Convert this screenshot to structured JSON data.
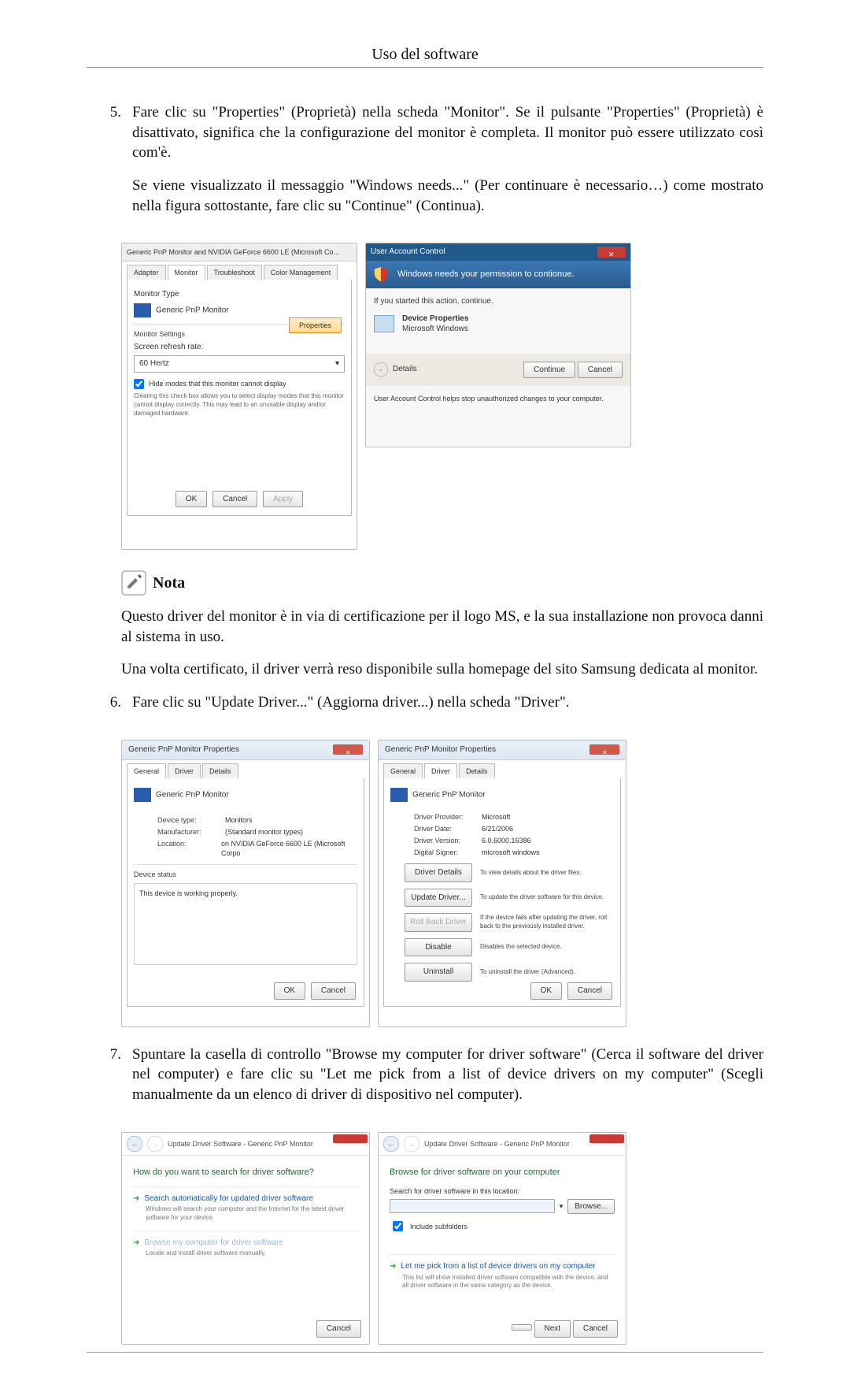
{
  "header": {
    "title": "Uso del software"
  },
  "steps": {
    "s5": {
      "num": "5.",
      "para1": "Fare clic su \"Properties\" (Proprietà) nella scheda \"Monitor\". Se il pulsante \"Properties\" (Proprietà) è disattivato, significa che la configurazione del monitor è completa. Il monitor può essere utilizzato così com'è.",
      "para2": "Se viene visualizzato il messaggio \"Windows needs...\" (Per continuare è necessario…) come mostrato nella figura sottostante, fare clic su \"Continue\" (Continua)."
    },
    "s6": {
      "num": "6.",
      "para1": "Fare clic su \"Update Driver...\" (Aggiorna driver...) nella scheda \"Driver\"."
    },
    "s7": {
      "num": "7.",
      "para1": "Spuntare la casella di controllo \"Browse my computer for driver software\" (Cerca il software del driver nel computer) e fare clic su \"Let me pick from a list of device drivers on my computer\" (Scegli manualmente da un elenco di driver di dispositivo nel computer)."
    }
  },
  "nota": {
    "label": "Nota",
    "p1": "Questo driver del monitor è in via di certificazione per il logo MS, e la sua installazione non provoca danni al sistema in uso.",
    "p2": "Una volta certificato, il driver verrà reso disponibile sulla homepage del sito Samsung dedicata al monitor."
  },
  "shot_monitor": {
    "title": "Generic PnP Monitor and NVIDIA GeForce 6600 LE (Microsoft Co...",
    "tabs": {
      "adapter": "Adapter",
      "monitor": "Monitor",
      "trouble": "Troubleshoot",
      "color": "Color Management"
    },
    "type_label": "Monitor Type",
    "type_value": "Generic PnP Monitor",
    "properties_btn": "Properties",
    "settings_label": "Monitor Settings",
    "refresh_label": "Screen refresh rate:",
    "refresh_value": "60 Hertz",
    "hide_modes": "Hide modes that this monitor cannot display",
    "hide_modes_desc": "Clearing this check box allows you to select display modes that this monitor cannot display correctly. This may lead to an unusable display and/or damaged hardware.",
    "ok": "OK",
    "cancel": "Cancel",
    "apply": "Apply"
  },
  "shot_uac": {
    "title": "User Account Control",
    "headline": "Windows needs your permission to contionue.",
    "if_started": "If you started this action, continue.",
    "dev_name": "Device Properties",
    "dev_vendor": "Microsoft Windows",
    "details": "Details",
    "continue": "Continue",
    "cancel": "Cancel",
    "footer": "User Account Control helps stop unauthorized changes to your computer."
  },
  "shot_general": {
    "title": "Generic PnP Monitor Properties",
    "tabs": {
      "general": "General",
      "driver": "Driver",
      "details": "Details"
    },
    "name": "Generic PnP Monitor",
    "kv": {
      "device_type_k": "Device type:",
      "device_type_v": "Monitors",
      "manufacturer_k": "Manufacturer:",
      "manufacturer_v": "(Standard monitor types)",
      "location_k": "Location:",
      "location_v": "on NVIDIA GeForce 6600 LE (Microsoft Corpo"
    },
    "status_label": "Device status",
    "status_text": "This device is working properly.",
    "ok": "OK",
    "cancel": "Cancel"
  },
  "shot_driver": {
    "title": "Generic PnP Monitor Properties",
    "name": "Generic PnP Monitor",
    "kv": {
      "provider_k": "Driver Provider:",
      "provider_v": "Microsoft",
      "date_k": "Driver Date:",
      "date_v": "6/21/2006",
      "version_k": "Driver Version:",
      "version_v": "6.0.6000.16386",
      "signer_k": "Digital Signer:",
      "signer_v": "microsoft windows"
    },
    "btns": {
      "details": "Driver Details",
      "details_d": "To view details about the driver files.",
      "update": "Update Driver...",
      "update_d": "To update the driver software for this device.",
      "rollback": "Roll Back Driver",
      "rollback_d": "If the device fails after updating the driver, roll back to the previously installed driver.",
      "disable": "Disable",
      "disable_d": "Disables the selected device.",
      "uninstall": "Uninstall",
      "uninstall_d": "To uninstall the driver (Advanced)."
    },
    "ok": "OK",
    "cancel": "Cancel"
  },
  "shot_wiz1": {
    "breadcrumb": "Update Driver Software - Generic PnP Monitor",
    "heading": "How do you want to search for driver software?",
    "opt1": "Search automatically for updated driver software",
    "opt1_sub": "Windows will search your computer and the Internet for the latest driver software for your device.",
    "opt2": "Browse my computer for driver software",
    "opt2_sub": "Locate and install driver software manually.",
    "cancel": "Cancel"
  },
  "shot_wiz2": {
    "breadcrumb": "Update Driver Software - Generic PnP Monitor",
    "heading": "Browse for driver software on your computer",
    "search_label": "Search for driver software in this location:",
    "browse": "Browse...",
    "include": "Include subfolders",
    "opt": "Let me pick from a list of device drivers on my computer",
    "opt_sub": "This list will show installed driver software compatible with the device, and all driver software in the same category as the device.",
    "next": "Next",
    "cancel": "Cancel"
  }
}
